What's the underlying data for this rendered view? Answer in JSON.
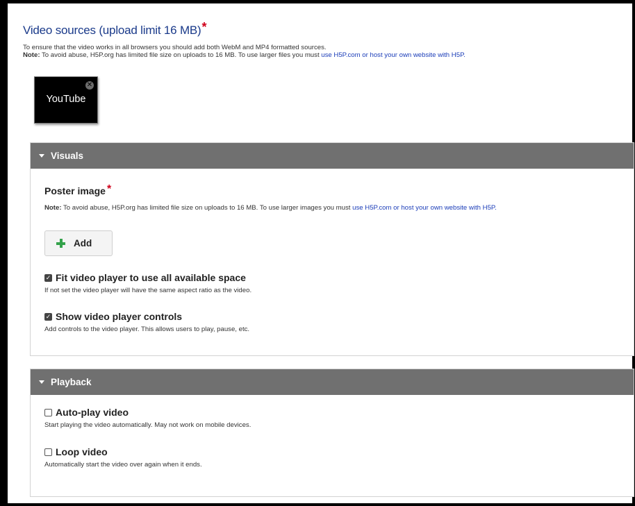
{
  "sources": {
    "title": "Video sources (upload limit 16 MB)",
    "required_marker": "*",
    "info_line": "To ensure that the video works in all browsers you should add both WebM and MP4 formatted sources.",
    "note_label": "Note:",
    "note_text": " To avoid abuse, H5P.org has limited file size on uploads to 16 MB. To use larger files you must ",
    "note_link": "use H5P.com or host your own website with H5P.",
    "items": [
      {
        "label": "YouTube",
        "remove_icon": "close-circle-icon"
      }
    ]
  },
  "visuals": {
    "header": "Visuals",
    "poster": {
      "title": "Poster image",
      "required_marker": "*",
      "note_label": "Note:",
      "note_text": " To avoid abuse, H5P.org has limited file size on uploads to 16 MB. To use larger images you must ",
      "note_link": "use H5P.com or host your own website with H5P.",
      "add_label": "Add",
      "add_icon": "plus-icon"
    },
    "fit": {
      "label": "Fit video player to use all available space",
      "checked": true,
      "description": "If not set the video player will have the same aspect ratio as the video."
    },
    "controls": {
      "label": "Show video player controls",
      "checked": true,
      "description": "Add controls to the video player. This allows users to play, pause, etc."
    }
  },
  "playback": {
    "header": "Playback",
    "autoplay": {
      "label": "Auto-play video",
      "checked": false,
      "description": "Start playing the video automatically. May not work on mobile devices."
    },
    "loop": {
      "label": "Loop video",
      "checked": false,
      "description": "Automatically start the video over again when it ends."
    }
  },
  "colors": {
    "title_blue": "#1a3a8a",
    "link_blue": "#1a3cb8",
    "required_red": "#d0021b",
    "group_header_gray": "#707070",
    "add_green": "#34a24b"
  }
}
